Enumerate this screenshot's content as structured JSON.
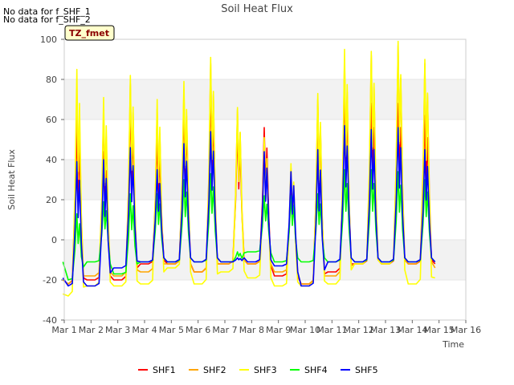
{
  "notices": [
    "No data for f_SHF_1",
    "No data for f_SHF_2"
  ],
  "chart_data": {
    "type": "line",
    "title": "Soil Heat Flux",
    "xlabel": "Time",
    "ylabel": "Soil Heat Flux",
    "ylim": [
      -40,
      100
    ],
    "yticks": [
      -40,
      -20,
      0,
      20,
      40,
      60,
      80,
      100
    ],
    "xlim": [
      1,
      16
    ],
    "xticks": [
      {
        "pos": 1,
        "label": "Mar 1"
      },
      {
        "pos": 2,
        "label": "Mar 2"
      },
      {
        "pos": 3,
        "label": "Mar 3"
      },
      {
        "pos": 4,
        "label": "Mar 4"
      },
      {
        "pos": 5,
        "label": "Mar 5"
      },
      {
        "pos": 6,
        "label": "Mar 6"
      },
      {
        "pos": 7,
        "label": "Mar 7"
      },
      {
        "pos": 8,
        "label": "Mar 8"
      },
      {
        "pos": 9,
        "label": "Mar 9"
      },
      {
        "pos": 10,
        "label": "Mar 10"
      },
      {
        "pos": 11,
        "label": "Mar 11"
      },
      {
        "pos": 12,
        "label": "Mar 12"
      },
      {
        "pos": 13,
        "label": "Mar 13"
      },
      {
        "pos": 14,
        "label": "Mar 14"
      },
      {
        "pos": 15,
        "label": "Mar 15"
      },
      {
        "pos": 16,
        "label": "Mar 16"
      }
    ],
    "annotation": "TZ_fmet",
    "grid": "horizontal bands",
    "legend_position": "bottom",
    "days": [
      1,
      2,
      3,
      4,
      5,
      6,
      7,
      8,
      9,
      10,
      11,
      12,
      13,
      14,
      15
    ],
    "series": [
      {
        "name": "SHF1",
        "color": "#ff0000",
        "start": -20,
        "peaks": [
          57,
          44,
          68,
          51,
          67,
          75,
          56,
          56,
          33,
          67,
          78,
          68,
          68,
          62
        ],
        "nights": [
          -22,
          -20,
          -20,
          -12,
          -12,
          -16,
          -12,
          -12,
          -18,
          -22,
          -16,
          -12,
          -12,
          -12,
          -12
        ]
      },
      {
        "name": "SHF2",
        "color": "#ffa500",
        "start": -20,
        "peaks": [
          73,
          64,
          78,
          65,
          75,
          88,
          65,
          45,
          36,
          70,
          90,
          92,
          97,
          88
        ],
        "nights": [
          -22,
          -18,
          -18,
          -16,
          -12,
          -16,
          -12,
          -12,
          -16,
          -22,
          -18,
          -12,
          -12,
          -12,
          -14
        ]
      },
      {
        "name": "SHF3",
        "color": "#ffff00",
        "start": -27,
        "peaks": [
          85,
          71,
          82,
          70,
          79,
          91,
          66,
          51,
          38,
          73,
          95,
          94,
          99,
          90
        ],
        "nights": [
          -28,
          -23,
          -23,
          -22,
          -14,
          -22,
          -16,
          -19,
          -23,
          -23,
          -22,
          -12,
          -12,
          -22,
          -19
        ]
      },
      {
        "name": "SHF4",
        "color": "#00ff00",
        "start": -11,
        "peaks": [
          13,
          19,
          23,
          23,
          30,
          33,
          -6,
          22,
          22,
          23,
          35,
          35,
          34,
          30
        ],
        "nights": [
          -20,
          -11,
          -17,
          -11,
          -11,
          -11,
          -11,
          -6,
          -11,
          -11,
          -11,
          -11,
          -11,
          -11,
          -11
        ]
      },
      {
        "name": "SHF5",
        "color": "#0000ff",
        "start": -19,
        "peaks": [
          39,
          40,
          46,
          35,
          48,
          54,
          -9,
          44,
          34,
          45,
          57,
          55,
          56,
          45
        ],
        "nights": [
          -23,
          -23,
          -14,
          -11,
          -11,
          -11,
          -11,
          -11,
          -13,
          -23,
          -11,
          -11,
          -11,
          -11,
          -11
        ]
      }
    ]
  }
}
